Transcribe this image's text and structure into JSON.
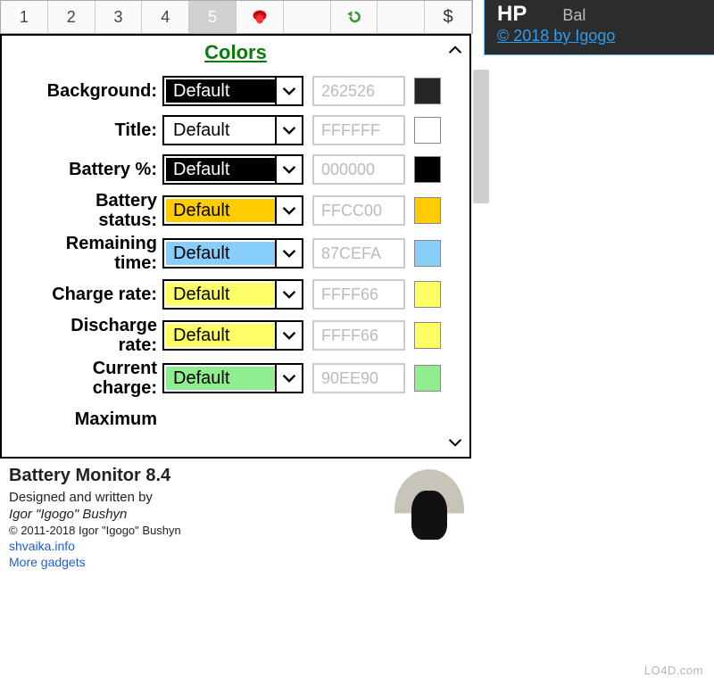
{
  "tabs": [
    "1",
    "2",
    "3",
    "4",
    "5"
  ],
  "active_tab_index": 4,
  "panel_title": "Colors",
  "color_rows": [
    {
      "label": "Background:",
      "value": "Default",
      "hex": "262526",
      "swatch": "#262526",
      "dd_bg": "#000000",
      "dd_fg": "#ffffff"
    },
    {
      "label": "Title:",
      "value": "Default",
      "hex": "FFFFFF",
      "swatch": "#FFFFFF",
      "dd_bg": "#ffffff",
      "dd_fg": "#000000"
    },
    {
      "label": "Battery %:",
      "value": "Default",
      "hex": "000000",
      "swatch": "#000000",
      "dd_bg": "#000000",
      "dd_fg": "#ffffff"
    },
    {
      "label": "Battery status:",
      "value": "Default",
      "hex": "FFCC00",
      "swatch": "#FFCC00",
      "dd_bg": "#FFCC00",
      "dd_fg": "#000000"
    },
    {
      "label": "Remaining time:",
      "value": "Default",
      "hex": "87CEFA",
      "swatch": "#87CEFA",
      "dd_bg": "#87CEFA",
      "dd_fg": "#000000"
    },
    {
      "label": "Charge rate:",
      "value": "Default",
      "hex": "FFFF66",
      "swatch": "#FFFF66",
      "dd_bg": "#FFFF66",
      "dd_fg": "#000000"
    },
    {
      "label": "Discharge rate:",
      "value": "Default",
      "hex": "FFFF66",
      "swatch": "#FFFF66",
      "dd_bg": "#FFFF66",
      "dd_fg": "#000000"
    },
    {
      "label": "Current charge:",
      "value": "Default",
      "hex": "90EE90",
      "swatch": "#90EE90",
      "dd_bg": "#90EE90",
      "dd_fg": "#000000"
    }
  ],
  "truncated_label": "Maximum",
  "about": {
    "title": "Battery Monitor 8.4",
    "designed": "Designed and written by",
    "author": "Igor \"Igogo\" Bushyn",
    "copyright": "© 2011-2018 Igor \"Igogo\" Bushyn",
    "link1": "shvaika.info",
    "link2": "More gadgets"
  },
  "popup": {
    "hp": "HP",
    "bal": "Bal",
    "link": "© 2018 by Igogo"
  },
  "watermark": "LO4D.com"
}
